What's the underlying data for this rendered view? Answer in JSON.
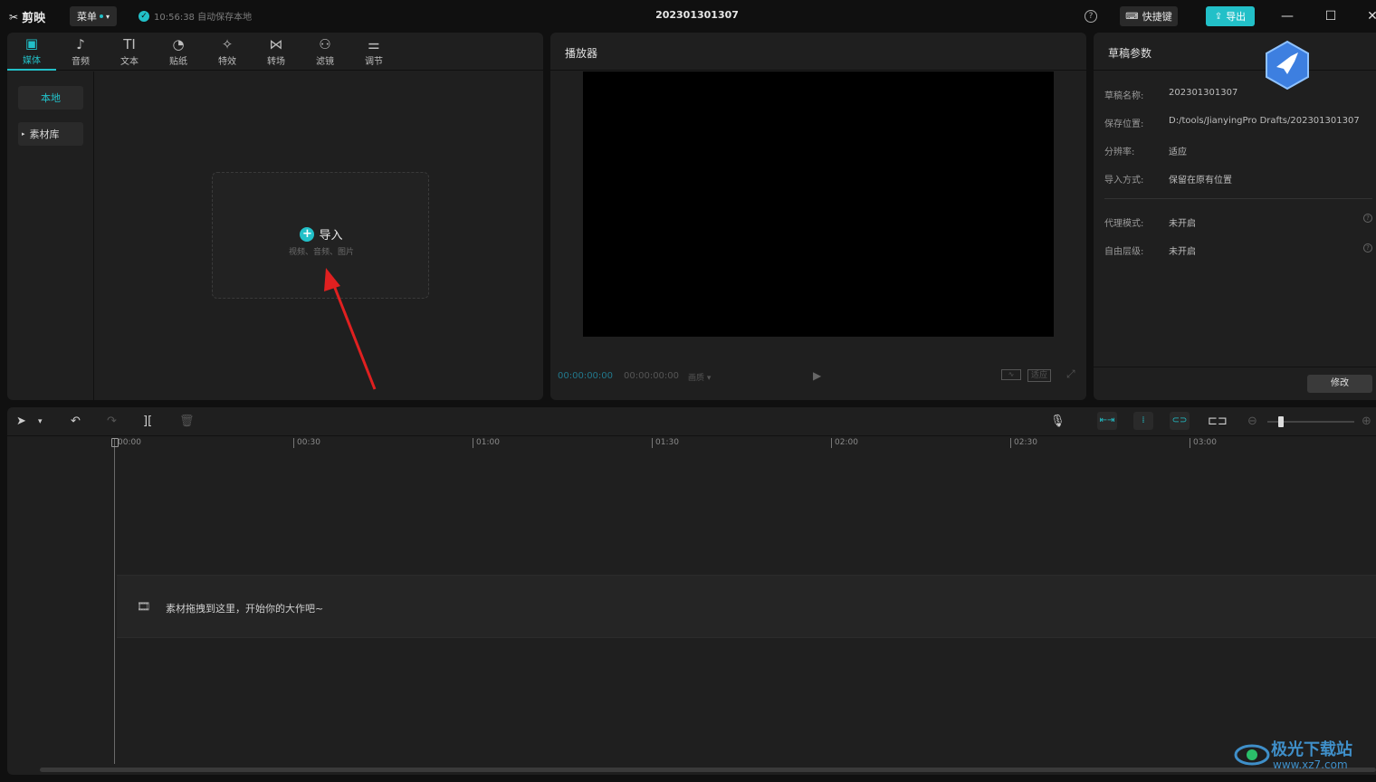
{
  "app": {
    "logo_text": "剪映",
    "menu_label": "菜单",
    "autosave": "10:56:38 自动保存本地",
    "project_title": "202301301307",
    "shortcut_label": "快捷键",
    "export_label": "导出",
    "help_glyph": "?"
  },
  "media_tabs": [
    {
      "label": "媒体",
      "icon": "media-icon"
    },
    {
      "label": "音频",
      "icon": "audio-icon"
    },
    {
      "label": "文本",
      "icon": "text-icon"
    },
    {
      "label": "贴纸",
      "icon": "sticker-icon"
    },
    {
      "label": "特效",
      "icon": "effects-icon"
    },
    {
      "label": "转场",
      "icon": "transition-icon"
    },
    {
      "label": "滤镜",
      "icon": "filter-icon"
    },
    {
      "label": "调节",
      "icon": "adjust-icon"
    }
  ],
  "sidenav": {
    "local": "本地",
    "library": "素材库"
  },
  "import": {
    "label": "导入",
    "subtitle": "视频、音频、图片"
  },
  "player": {
    "title": "播放器",
    "time_current": "00:00:00:00",
    "time_total": "00:00:00:00",
    "quality": "画质",
    "fit_label": "适应"
  },
  "props": {
    "title": "草稿参数",
    "rows": [
      {
        "key": "草稿名称:",
        "value": "202301301307"
      },
      {
        "key": "保存位置:",
        "value": "D:/tools/JianyingPro Drafts/202301301307"
      },
      {
        "key": "分辨率:",
        "value": "适应"
      },
      {
        "key": "导入方式:",
        "value": "保留在原有位置"
      },
      {
        "key": "代理模式:",
        "value": "未开启"
      },
      {
        "key": "自由层级:",
        "value": "未开启"
      }
    ],
    "modify_label": "修改"
  },
  "timeline": {
    "ruler": [
      "00:00",
      "00:30",
      "01:00",
      "01:30",
      "02:00",
      "02:30",
      "03:00"
    ],
    "drop_hint": "素材拖拽到这里，开始你的大作吧~"
  },
  "watermark": {
    "text": "极光下载站",
    "url": "www.xz7.com"
  },
  "colors": {
    "accent": "#22c0c8",
    "bg": "#101010",
    "panel": "#1f1f1f"
  }
}
